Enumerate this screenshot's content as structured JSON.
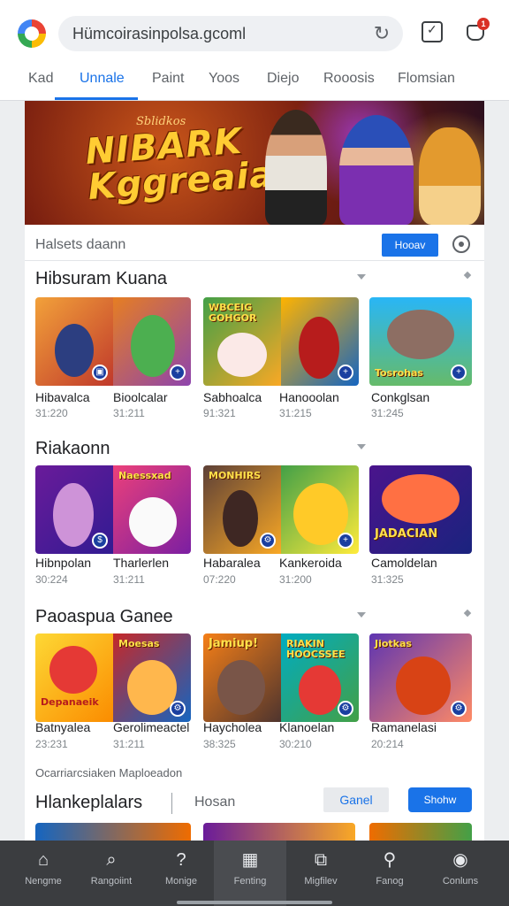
{
  "browser": {
    "url": "Hümcoirasinpolsa.gcoml",
    "notification_count": "1"
  },
  "tabs": [
    {
      "label": "Kad"
    },
    {
      "label": "Unnale",
      "active": true
    },
    {
      "label": "Paint"
    },
    {
      "label": "Yoos"
    },
    {
      "label": "Diejo"
    },
    {
      "label": "Rooosis"
    },
    {
      "label": "Flomsian"
    }
  ],
  "banner": {
    "small": "Sblidkos",
    "title_line1": "NIBARK",
    "title_line2": "Kggreaia!"
  },
  "section_bar": {
    "label": "Halsets daann",
    "button": "Hooav"
  },
  "sections": [
    {
      "title": "Hibsuram Kuana",
      "games": [
        {
          "name": "Hibavalca",
          "meta": "31:220",
          "label": "",
          "badge": "▣"
        },
        {
          "name": "Bioolcalar",
          "meta": "31:211",
          "label": ""
        },
        {
          "name": "Sabhoalca",
          "meta": "91:321",
          "label": "WBCEIG GOHGOR"
        },
        {
          "name": "Hanooolan",
          "meta": "31:215",
          "label": ""
        },
        {
          "name": "Conkglsan",
          "meta": "31:245",
          "label": "Tosrohas"
        }
      ]
    },
    {
      "title": "Riakaonn",
      "games": [
        {
          "name": "Hibnpolan",
          "meta": "30:224",
          "label": ""
        },
        {
          "name": "Tharlerlen",
          "meta": "31:211",
          "label": "Naessxad"
        },
        {
          "name": "Habaralea",
          "meta": "07:220",
          "label": "MONHIRS"
        },
        {
          "name": "Kankeroida",
          "meta": "31:200",
          "label": ""
        },
        {
          "name": "Camoldelan",
          "meta": "31:325",
          "label": "JADACIAN"
        }
      ]
    },
    {
      "title": "Paoaspua Ganee",
      "games": [
        {
          "name": "Batnyalea",
          "meta": "23:231",
          "label": "Depanaeik"
        },
        {
          "name": "Gerolimeactel",
          "meta": "31:211",
          "label": "Moesas"
        },
        {
          "name": "Haycholea",
          "meta": "38:325",
          "label": "Jamiup!"
        },
        {
          "name": "Klanoelan",
          "meta": "30:210",
          "label": "RIAKIN HOOCSSEE"
        },
        {
          "name": "Ramanelasi",
          "meta": "20:214",
          "label": "Jiotkas"
        }
      ]
    }
  ],
  "footer": {
    "line": "Ocarriarcsiaken  Maploeadon",
    "title": "Hlankeplalars",
    "subtitle": "Hosan",
    "cancel": "Ganel",
    "show": "Shohw"
  },
  "bottom_nav": [
    {
      "label": "Nengme",
      "icon": "home-icon",
      "glyph": "⌂"
    },
    {
      "label": "Rangoiint",
      "icon": "search-bubble-icon",
      "glyph": "⌕"
    },
    {
      "label": "Monige",
      "icon": "help-icon",
      "glyph": "?"
    },
    {
      "label": "Fenting",
      "icon": "grid-icon",
      "glyph": "▦",
      "active": true
    },
    {
      "label": "Migfilev",
      "icon": "frame-icon",
      "glyph": "⧉"
    },
    {
      "label": "Fanog",
      "icon": "search-icon",
      "glyph": "⚲"
    },
    {
      "label": "Conluns",
      "icon": "person-icon",
      "glyph": "◉"
    }
  ],
  "colors": {
    "accent": "#1a73e8",
    "nav_bg": "#3b3d40",
    "notification": "#d93025"
  }
}
